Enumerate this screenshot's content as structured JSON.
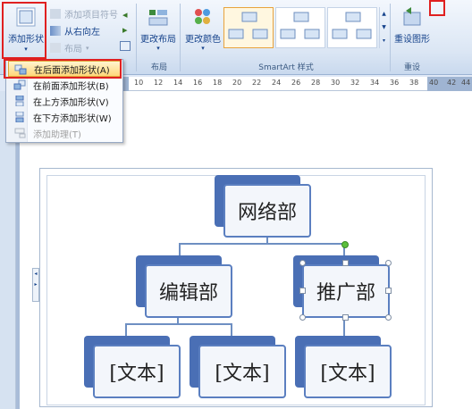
{
  "ribbon": {
    "add_shape_label": "添加形状",
    "add_bullet_label": "添加项目符号",
    "right_to_left_label": "从右向左",
    "layout_small_label": "布局",
    "change_layout_label": "更改布局",
    "change_color_label": "更改颜色",
    "reset_graphic_label": "重设图形",
    "group_layout": "布局",
    "group_styles": "SmartArt 样式",
    "group_reset": "重设"
  },
  "ruler": {
    "ticks": [
      "10",
      "12",
      "14",
      "16",
      "18",
      "20",
      "22",
      "24",
      "26",
      "28",
      "30",
      "32",
      "34",
      "36",
      "38",
      "40",
      "42",
      "44"
    ]
  },
  "menu": {
    "items": [
      {
        "label": "在后面添加形状(A)"
      },
      {
        "label": "在前面添加形状(B)"
      },
      {
        "label": "在上方添加形状(V)"
      },
      {
        "label": "在下方添加形状(W)"
      },
      {
        "label": "添加助理(T)"
      }
    ]
  },
  "smartart": {
    "root": "网络部",
    "level2": [
      "编辑部",
      "推广部"
    ],
    "level3": [
      "[文本]",
      "[文本]",
      "[文本]"
    ]
  },
  "colors": {
    "accent_red": "#e02020",
    "node_blue": "#4a6fb5",
    "menu_highlight": "#ffd87a"
  }
}
